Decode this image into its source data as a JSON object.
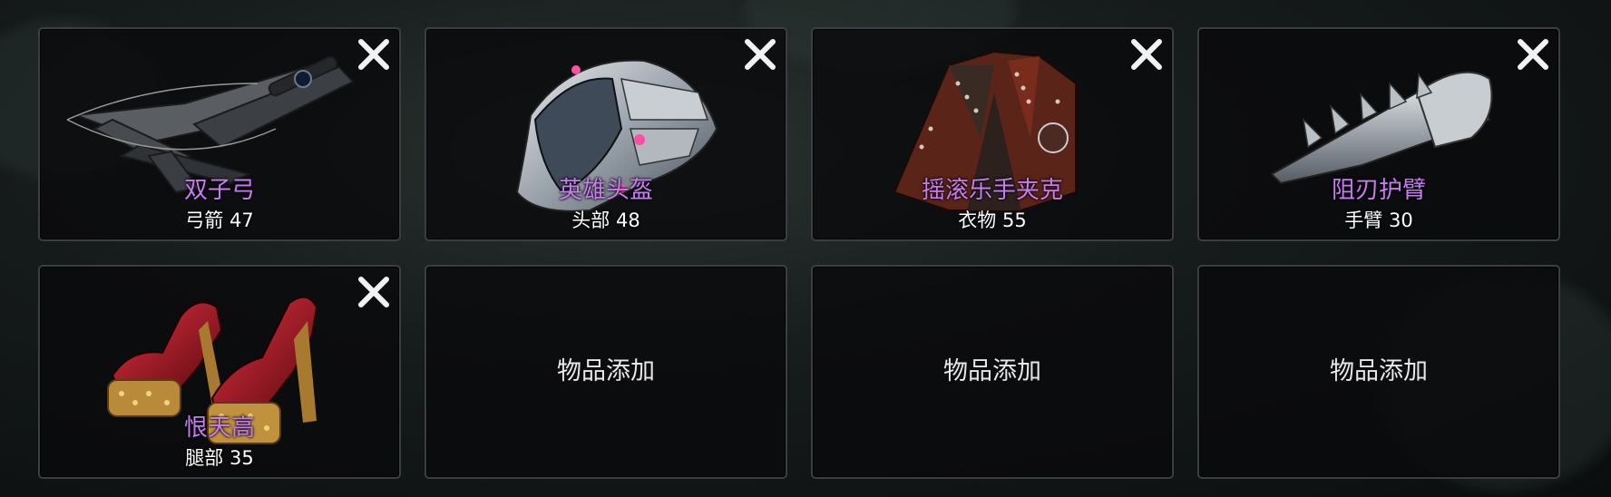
{
  "slots": [
    {
      "name": "双子弓",
      "category": "弓箭",
      "level": "47",
      "icon": "crossbow-icon"
    },
    {
      "name": "英雄头盔",
      "category": "头部",
      "level": "48",
      "icon": "helmet-icon"
    },
    {
      "name": "摇滚乐手夹克",
      "category": "衣物",
      "level": "55",
      "icon": "jacket-icon"
    },
    {
      "name": "阻刃护臂",
      "category": "手臂",
      "level": "30",
      "icon": "bracer-icon"
    },
    {
      "name": "恨天高",
      "category": "腿部",
      "level": "35",
      "icon": "high-heels-icon"
    }
  ],
  "empty_slots": [
    {
      "label": "物品添加"
    },
    {
      "label": "物品添加"
    },
    {
      "label": "物品添加"
    }
  ],
  "colors": {
    "item_name": "#c77df0",
    "stat_text": "#ffffff",
    "slot_border": "#3b3f44"
  }
}
